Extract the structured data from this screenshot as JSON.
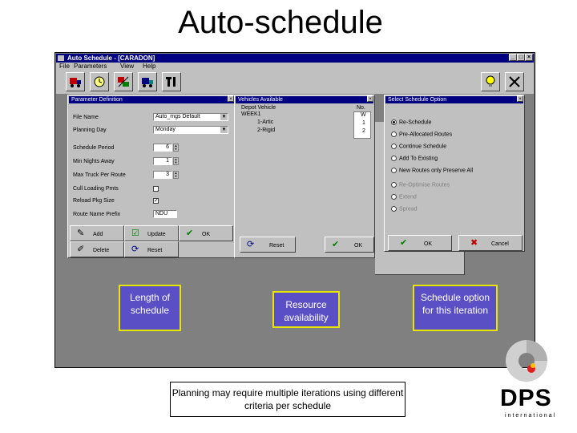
{
  "slide": {
    "title": "Auto-schedule"
  },
  "app": {
    "title": "Auto Schedule - [CARADON]",
    "window_buttons": [
      "_",
      "□",
      "×"
    ],
    "menu": [
      "File",
      "Parameters",
      "View",
      "Help"
    ]
  },
  "param_dialog": {
    "title": "Parameter Definition",
    "fields": [
      {
        "label": "File Name",
        "value": "Auto_mgs Default"
      },
      {
        "label": "Planning Day",
        "value": "Monday"
      },
      {
        "label": "Schedule Period",
        "value": "6"
      },
      {
        "label": "Min Nights Away",
        "value": "1"
      },
      {
        "label": "Max Truck Per Route",
        "value": "3"
      },
      {
        "label": "Cull Loading Pmts",
        "value": ""
      },
      {
        "label": "Reload Pkg Size",
        "value": ""
      },
      {
        "label": "Route Name Prefix",
        "value": "NDU"
      }
    ],
    "buttons": {
      "add": "Add",
      "update": "Update",
      "ok": "OK",
      "delete": "Delete",
      "reset": "Reset"
    }
  },
  "vehicles_dialog": {
    "title": "Vehicles Available",
    "col_depot": "Depot   Vehicle",
    "col_no": "No.",
    "rows": [
      {
        "name": "WEEK1",
        "no": "W"
      },
      {
        "name": "1-Artic",
        "no": "1"
      },
      {
        "name": "2-Rigid",
        "no": "2"
      }
    ],
    "buttons": {
      "reset": "Reset",
      "ok": "OK"
    }
  },
  "options_dialog": {
    "title": "Select Schedule Option",
    "options": [
      {
        "label": "Re-Schedule",
        "selected": true,
        "disabled": false
      },
      {
        "label": "Pre-Allocated Routes",
        "selected": false,
        "disabled": false
      },
      {
        "label": "Continue Schedule",
        "selected": false,
        "disabled": false
      },
      {
        "label": "Add To Existing",
        "selected": false,
        "disabled": false
      },
      {
        "label": "New Routes only Preserve All",
        "selected": false,
        "disabled": false
      },
      {
        "label": "Re-Optimise Routes",
        "selected": false,
        "disabled": true
      },
      {
        "label": "Extend",
        "selected": false,
        "disabled": true
      },
      {
        "label": "Spread",
        "selected": false,
        "disabled": true
      }
    ],
    "buttons": {
      "ok": "OK",
      "cancel": "Cancel"
    }
  },
  "callouts": {
    "length": "Length of schedule",
    "resource": "Resource availability",
    "option": "Schedule option for this iteration"
  },
  "note": "Planning may require multiple iterations using different criteria per schedule",
  "logo": {
    "text": "DPS",
    "sub": "international"
  },
  "colors": {
    "callout_bg": "#5a4fc4",
    "callout_border": "#e6e600",
    "titlebar": "#000080",
    "window_bg": "#c0c0c0"
  }
}
